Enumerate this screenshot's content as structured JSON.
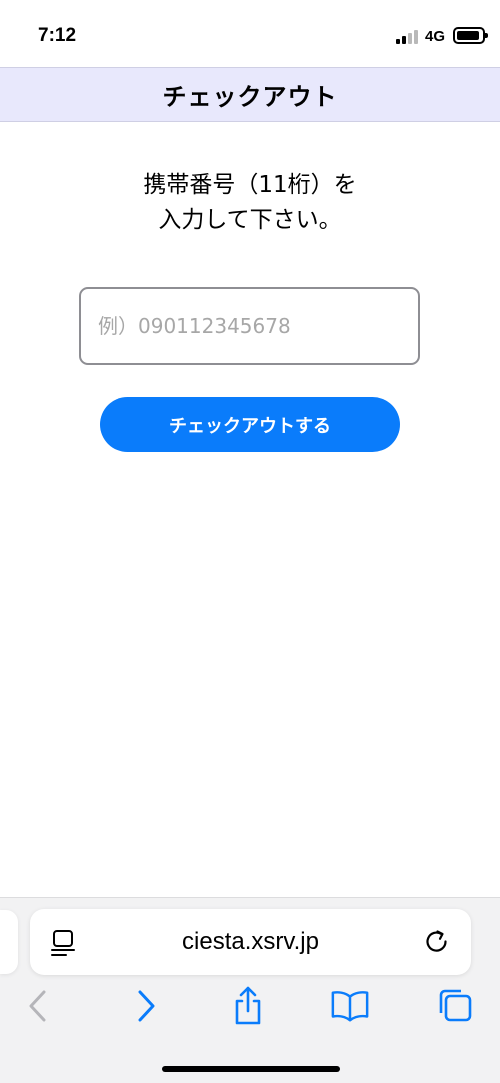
{
  "status_bar": {
    "time": "7:12",
    "network": "4G"
  },
  "header": {
    "title": "チェックアウト"
  },
  "main": {
    "prompt_line1": "携帯番号（11桁）を",
    "prompt_line2": "入力して下さい。",
    "phone_input": {
      "value": "",
      "placeholder": "例）090112345678"
    },
    "checkout_button_label": "チェックアウトする"
  },
  "browser": {
    "url": "ciesta.xsrv.jp",
    "toolbar": [
      "back-icon",
      "forward-icon",
      "share-icon",
      "bookmarks-icon",
      "tabs-icon"
    ]
  },
  "colors": {
    "header_bg": "#e8e8fc",
    "accent": "#0a7cfb",
    "disabled_icon": "#b5b5b9"
  }
}
